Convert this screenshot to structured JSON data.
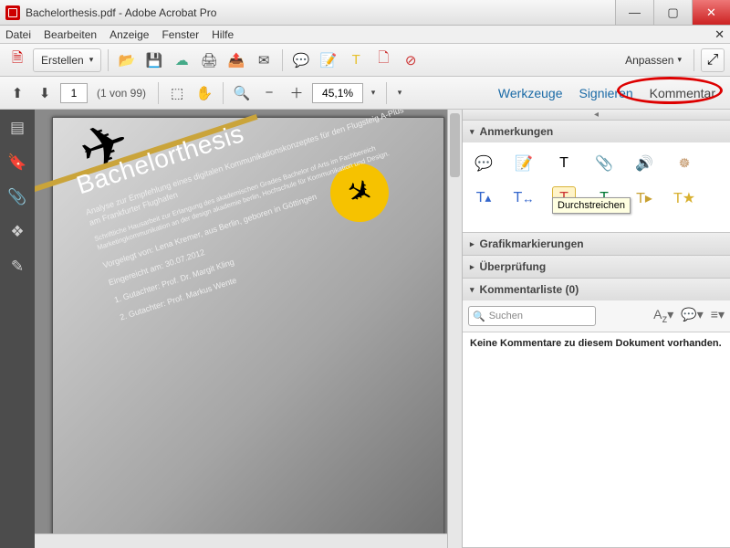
{
  "window": {
    "title": "Bachelorthesis.pdf - Adobe Acrobat Pro"
  },
  "menu": {
    "items": [
      "Datei",
      "Bearbeiten",
      "Anzeige",
      "Fenster",
      "Hilfe"
    ]
  },
  "toolbar1": {
    "create_label": "Erstellen",
    "anpassen": "Anpassen"
  },
  "toolbar2": {
    "page_value": "1",
    "page_count": "(1 von 99)",
    "zoom_value": "45,1%",
    "tabs": {
      "werkzeuge": "Werkzeuge",
      "signieren": "Signieren",
      "kommentar": "Kommentar"
    }
  },
  "comment_panel": {
    "sections": {
      "annotations": "Anmerkungen",
      "grafik": "Grafikmarkierungen",
      "ueberpruefung": "Überprüfung",
      "liste": "Kommentarliste (0)"
    },
    "tooltip": "Durchstreichen",
    "search_placeholder": "Suchen",
    "empty_msg": "Keine Kommentare zu diesem Dokument vorhanden."
  },
  "document": {
    "title": "Bachelorthesis",
    "subtitle": "Analyse zur Empfehlung eines digitalen Kommunikationskonzeptes für den Flugsteig A-Plus am Frankfurter Flughafen",
    "note": "Schriftliche Hausarbeit zur Erlangung des akademischen Grades Bachelor of Arts im Fachbereich Marketingkommunikation an der design akademie berlin, Hochschule für Kommunikation und Design.",
    "author": "Vorgelegt von: Lena Kremer, aus Berlin, geboren in Göttingen",
    "date": "Eingereicht am: 30.07.2012",
    "g1": "1. Gutachter: Prof. Dr. Margit Kling",
    "g2": "2. Gutachter: Prof. Markus Wente"
  }
}
